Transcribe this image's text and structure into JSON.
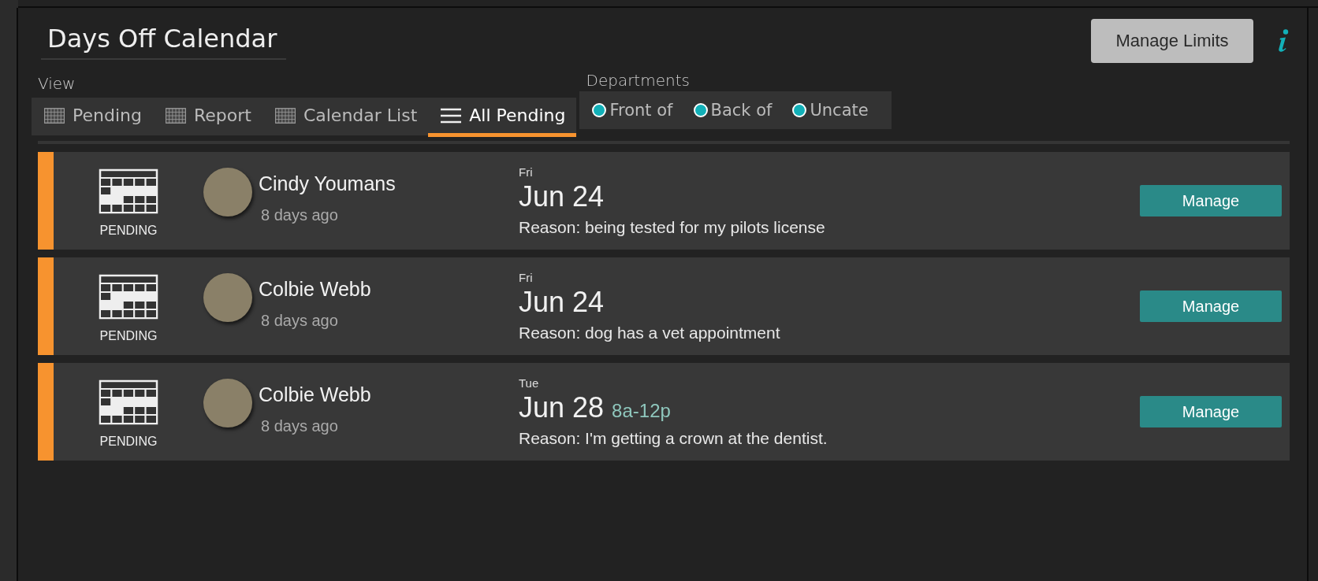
{
  "header": {
    "title": "Days Off Calendar",
    "manage_limits_button": "Manage Limits"
  },
  "view": {
    "label": "View",
    "tabs": [
      {
        "label": "Pending",
        "kind": "grid",
        "selected": false
      },
      {
        "label": "Report",
        "kind": "grid",
        "selected": false
      },
      {
        "label": "Calendar List",
        "kind": "grid",
        "selected": false
      },
      {
        "label": "All Pending",
        "kind": "list",
        "selected": true
      }
    ]
  },
  "departments": {
    "label": "Departments",
    "items": [
      {
        "label": "Front of",
        "checked": true
      },
      {
        "label": "Back of",
        "checked": true
      },
      {
        "label": "Uncate",
        "checked": true
      }
    ]
  },
  "requests": [
    {
      "status": "PENDING",
      "name": "Cindy Youmans",
      "submitted": "8 days ago",
      "weekday": "Fri",
      "date": "Jun 24",
      "reason": "Reason: being tested for my pilots license",
      "button": "Manage"
    },
    {
      "status": "PENDING",
      "name": "Colbie Webb",
      "submitted": "8 days ago",
      "weekday": "Fri",
      "date": "Jun 24",
      "reason": "Reason: dog has a vet appointment",
      "button": "Manage"
    },
    {
      "status": "PENDING",
      "name": "Colbie Webb",
      "submitted": "8 days ago",
      "weekday": "Tue",
      "date": "Jun 28",
      "time": "8a-12p",
      "reason": "Reason: I'm getting a crown at the dentist.",
      "button": "Manage"
    }
  ]
}
